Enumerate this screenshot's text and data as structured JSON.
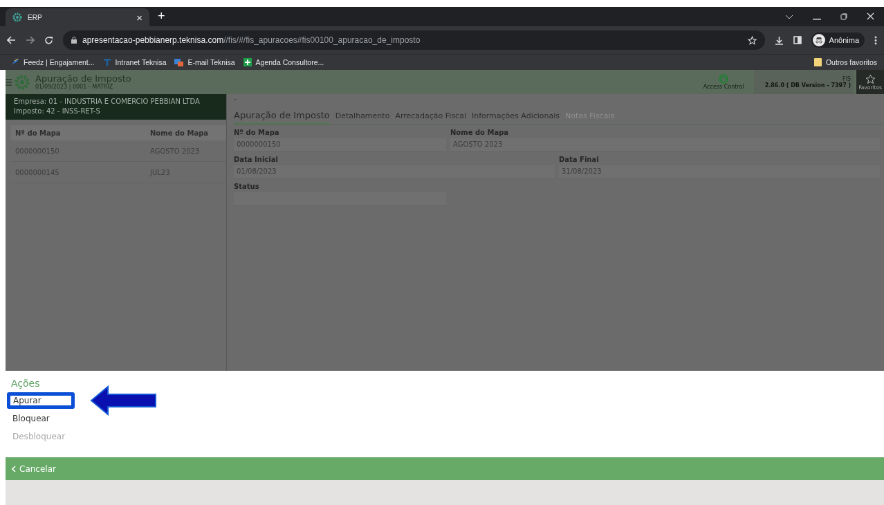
{
  "browser": {
    "tab_title": "ERP",
    "tab_close": "×",
    "new_tab": "+",
    "url_host": "apresentacao-pebbianerp.teknisa.com",
    "url_path": "//fis/#/fis_apuracoes#fis00100_apuracao_de_imposto",
    "profile": "Anônima",
    "bookmarks": [
      {
        "label": "Feedz | Engajament...",
        "kind": "feather"
      },
      {
        "label": "Intranet Teknisa",
        "kind": "t"
      },
      {
        "label": "E-mail Teknisa",
        "kind": "mail"
      },
      {
        "label": "Agenda Consultore...",
        "kind": "plus"
      }
    ],
    "other_bookmarks": "Outros favoritos"
  },
  "app_header": {
    "title": "Apuração de Imposto",
    "subtitle": "01/09/2023 | 0001 - MATRIZ",
    "access_control": "Access Control",
    "module": "FIS",
    "version": "2.86.0 ( DB Version - 7397 )",
    "favorites": "Favoritos"
  },
  "context": {
    "company": "Empresa: 01 - INDUSTRIA E COMERCIO PEBBIAN LTDA",
    "tax": "Imposto: 42 - INSS-RET-S"
  },
  "list": {
    "columns": [
      "Nº do Mapa",
      "Nome do Mapa"
    ],
    "rows": [
      [
        "0000000150",
        "AGOSTO 2023"
      ],
      [
        "0000000145",
        "JUL23"
      ]
    ]
  },
  "detail": {
    "breadcrumb": "-",
    "tabs": [
      {
        "label": "Apuração de Imposto",
        "selected": true,
        "disabled": false
      },
      {
        "label": "Detalhamento",
        "selected": false,
        "disabled": false
      },
      {
        "label": "Arrecadação Fiscal",
        "selected": false,
        "disabled": false
      },
      {
        "label": "Informações Adicionais",
        "selected": false,
        "disabled": false
      },
      {
        "label": "Notas Fiscais",
        "selected": false,
        "disabled": true
      }
    ],
    "fields": [
      {
        "label": "Nº do Mapa",
        "value": "0000000150"
      },
      {
        "label": "Nome do Mapa",
        "value": "AGOSTO 2023"
      },
      {
        "label": "Data Inicial",
        "value": "01/08/2023"
      },
      {
        "label": "Data Final",
        "value": "31/08/2023"
      },
      {
        "label": "Status"
      }
    ]
  },
  "actions": {
    "title": "Ações",
    "items": [
      {
        "label": "Apurar",
        "disabled": false,
        "highlighted": true
      },
      {
        "label": "Bloquear",
        "disabled": false,
        "highlighted": false
      },
      {
        "label": "Desbloquear",
        "disabled": true,
        "highlighted": false
      }
    ],
    "cancel": "Cancelar"
  }
}
